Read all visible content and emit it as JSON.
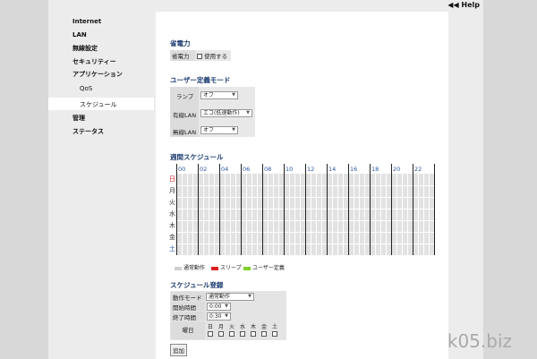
{
  "header": {
    "help_label": "Help",
    "help_icon": "double-left-arrow-icon"
  },
  "sidebar": {
    "items": [
      {
        "label": "Internet"
      },
      {
        "label": "LAN"
      },
      {
        "label": "無線設定"
      },
      {
        "label": "セキュリティー"
      },
      {
        "label": "アプリケーション"
      },
      {
        "label": "QoS"
      },
      {
        "label": "スケジュール"
      },
      {
        "label": "管理"
      },
      {
        "label": "ステータス"
      }
    ]
  },
  "power": {
    "title": "省電力",
    "row_label": "省電力",
    "checkbox_label": "使用する"
  },
  "user_mode": {
    "title": "ユーザー定義モード",
    "rows": [
      {
        "label": "ランプ",
        "value": "オフ"
      },
      {
        "label": "有線LAN",
        "value": "エコ(低速動作)"
      },
      {
        "label": "無線LAN",
        "value": "オフ"
      }
    ]
  },
  "weekly": {
    "title": "週間スケジュール",
    "hours": [
      "00",
      "02",
      "04",
      "06",
      "08",
      "10",
      "12",
      "14",
      "16",
      "18",
      "20",
      "22"
    ],
    "days": [
      "日",
      "月",
      "火",
      "水",
      "木",
      "金",
      "土"
    ]
  },
  "legend": {
    "normal": "通常動作",
    "sleep": "スリープ",
    "user": "ユーザー定義",
    "colors": {
      "normal": "#cfcfcf",
      "sleep": "#e02020",
      "user": "#7fd02a"
    }
  },
  "register": {
    "title": "スケジュール登録",
    "mode_label": "動作モード",
    "mode_value": "通常動作",
    "start_label": "開始時間",
    "start_value": "0:00",
    "end_label": "終了時間",
    "end_value": "0:30",
    "weekday_label": "曜日",
    "weekdays": [
      "日",
      "月",
      "火",
      "水",
      "木",
      "金",
      "土"
    ],
    "add_button": "追加"
  },
  "watermark": "k05.biz"
}
